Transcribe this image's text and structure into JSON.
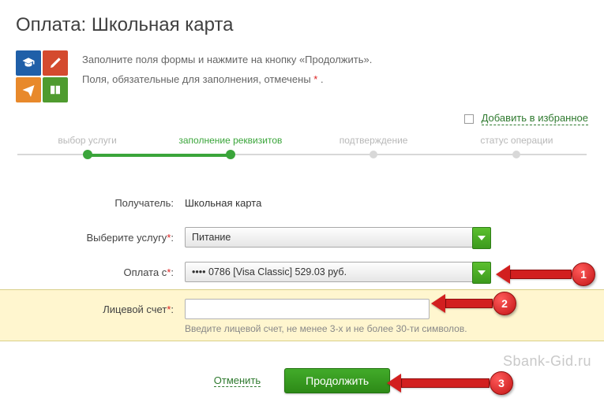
{
  "title": "Оплата: Школьная карта",
  "intro": {
    "line1": "Заполните поля формы и нажмите на кнопку «Продолжить».",
    "line2_prefix": "Поля, обязательные для заполнения, отмечены ",
    "line2_star": "*",
    "line2_suffix": " ."
  },
  "favorite": {
    "label": "Добавить в избранное"
  },
  "stepper": {
    "steps": [
      "выбор услуги",
      "заполнение реквизитов",
      "подтверждение",
      "статус операции"
    ],
    "current_index": 1
  },
  "form": {
    "recipient_label": "Получатель:",
    "recipient_value": "Школьная карта",
    "service_label": "Выберите услугу",
    "service_value": "Питание",
    "pay_from_label": "Оплата с",
    "pay_from_value": "•••• 0786 [Visa Classic] 529.03 руб.",
    "account_label": "Лицевой счет",
    "account_value": "",
    "account_hint": "Введите лицевой счет, не менее 3-х и не более 30-ти символов.",
    "star": "*",
    "colon": ":"
  },
  "buttons": {
    "cancel": "Отменить",
    "continue": "Продолжить"
  },
  "callouts": {
    "n1": "1",
    "n2": "2",
    "n3": "3"
  },
  "watermark": "Sbank-Gid.ru"
}
